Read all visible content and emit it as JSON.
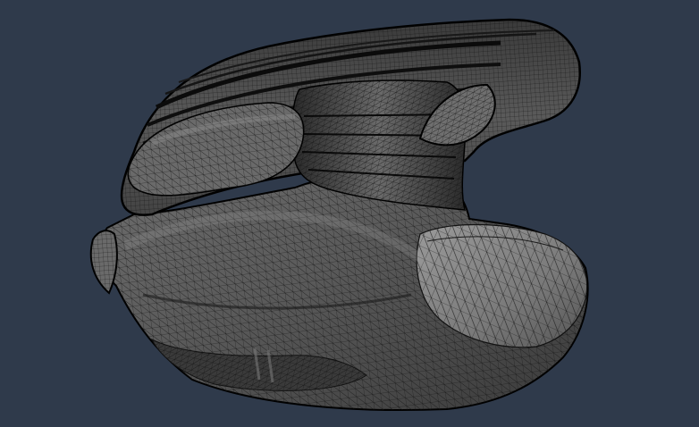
{
  "viewport": {
    "background": "#2f3a4b",
    "render_mode": "shaded-wireframe",
    "mesh_fill": "#545454",
    "mesh_highlight": "#8a8a8a",
    "mesh_shadow": "#1e1e1e",
    "wire_color": "#121212",
    "outline_color": "#000000"
  }
}
